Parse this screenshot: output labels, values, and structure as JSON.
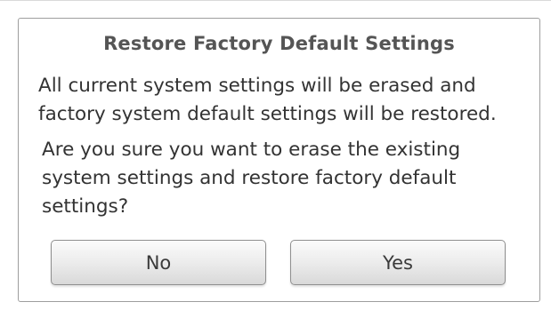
{
  "dialog": {
    "title": "Restore Factory Default Settings",
    "message_info": "All current system settings will be erased and factory system default settings will be restored.",
    "message_confirm": "Are you sure you want to erase the existing system settings and restore factory default settings?",
    "buttons": {
      "no_label": "No",
      "yes_label": "Yes"
    }
  }
}
